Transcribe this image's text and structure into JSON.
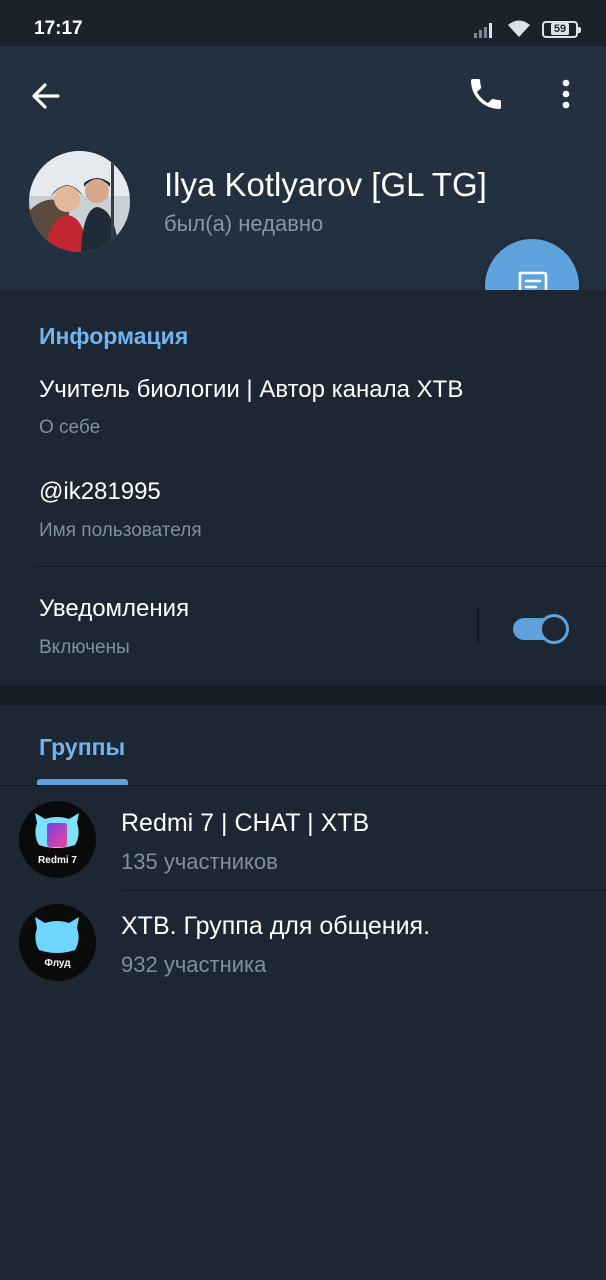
{
  "status_bar": {
    "time": "17:17",
    "battery": "59",
    "icons": [
      "signal-icon",
      "wifi-icon",
      "battery-icon"
    ]
  },
  "header": {
    "back_icon": "arrow-left-icon",
    "call_icon": "phone-icon",
    "more_icon": "more-vertical-icon",
    "name": "Ilya Kotlyarov [GL TG]",
    "status": "был(а) недавно"
  },
  "fab": {
    "icon": "message-icon"
  },
  "info": {
    "title": "Информация",
    "bio": {
      "value": "Учитель биологии | Автор канала XTB",
      "label": "О себе"
    },
    "username": {
      "value": "@ik281995",
      "label": "Имя пользователя"
    },
    "notifications": {
      "value": "Уведомления",
      "label": "Включены",
      "enabled": true
    }
  },
  "groups": {
    "tab_label": "Группы",
    "items": [
      {
        "name": "Redmi 7 | CHAT | XTB",
        "members": "135 участников",
        "avatar_label": "Redmi 7"
      },
      {
        "name": "XTB. Группа для общения.",
        "members": "932 участника",
        "avatar_label": "Флуд"
      }
    ]
  },
  "colors": {
    "background": "#1d2733",
    "header": "#233040",
    "accent": "#5fa3de",
    "section_title": "#71b4ef",
    "secondary_text": "#7f8e9e"
  }
}
